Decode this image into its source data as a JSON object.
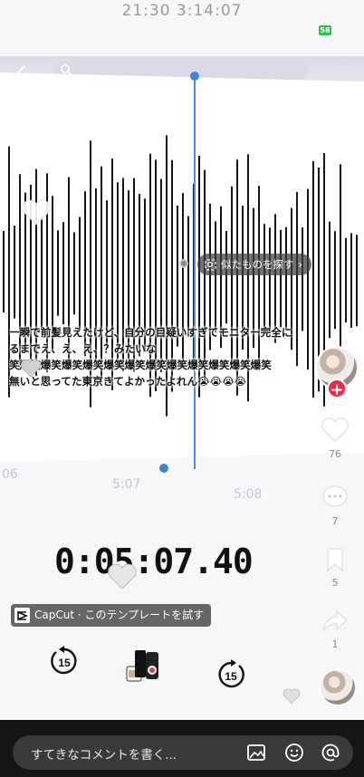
{
  "status": {
    "time": "21:30  3:14:07",
    "battery": "58"
  },
  "waveform": {
    "similar_button": "似たものを探す",
    "ticks": [
      {
        "label": "06"
      },
      {
        "label": "5:07"
      },
      {
        "label": "5:08"
      }
    ]
  },
  "caption": {
    "lines": [
      "一瞬で前髪見えたけど、自分の目疑いすぎてモニター完全に",
      "るまでえ、え、え、？みたいな",
      "笑爆笑爆笑爆笑爆笑爆笑爆笑爆笑爆笑爆笑爆笑爆笑爆笑",
      "無いと思ってた東京きてよかったよれん😭😭😭😭"
    ]
  },
  "timer": "0:05:07.40",
  "capcut": {
    "label": "CapCut · このテンプレートを試す"
  },
  "controls": {
    "rewind": "15",
    "forward": "15"
  },
  "side_actions": {
    "likes": "76",
    "comments": "7",
    "saves": "5",
    "shares": "1"
  },
  "comment_bar": {
    "placeholder": "すてきなコメントを書く..."
  },
  "colors": {
    "accent": "#3d86d6",
    "follow": "#ee2a4a"
  }
}
